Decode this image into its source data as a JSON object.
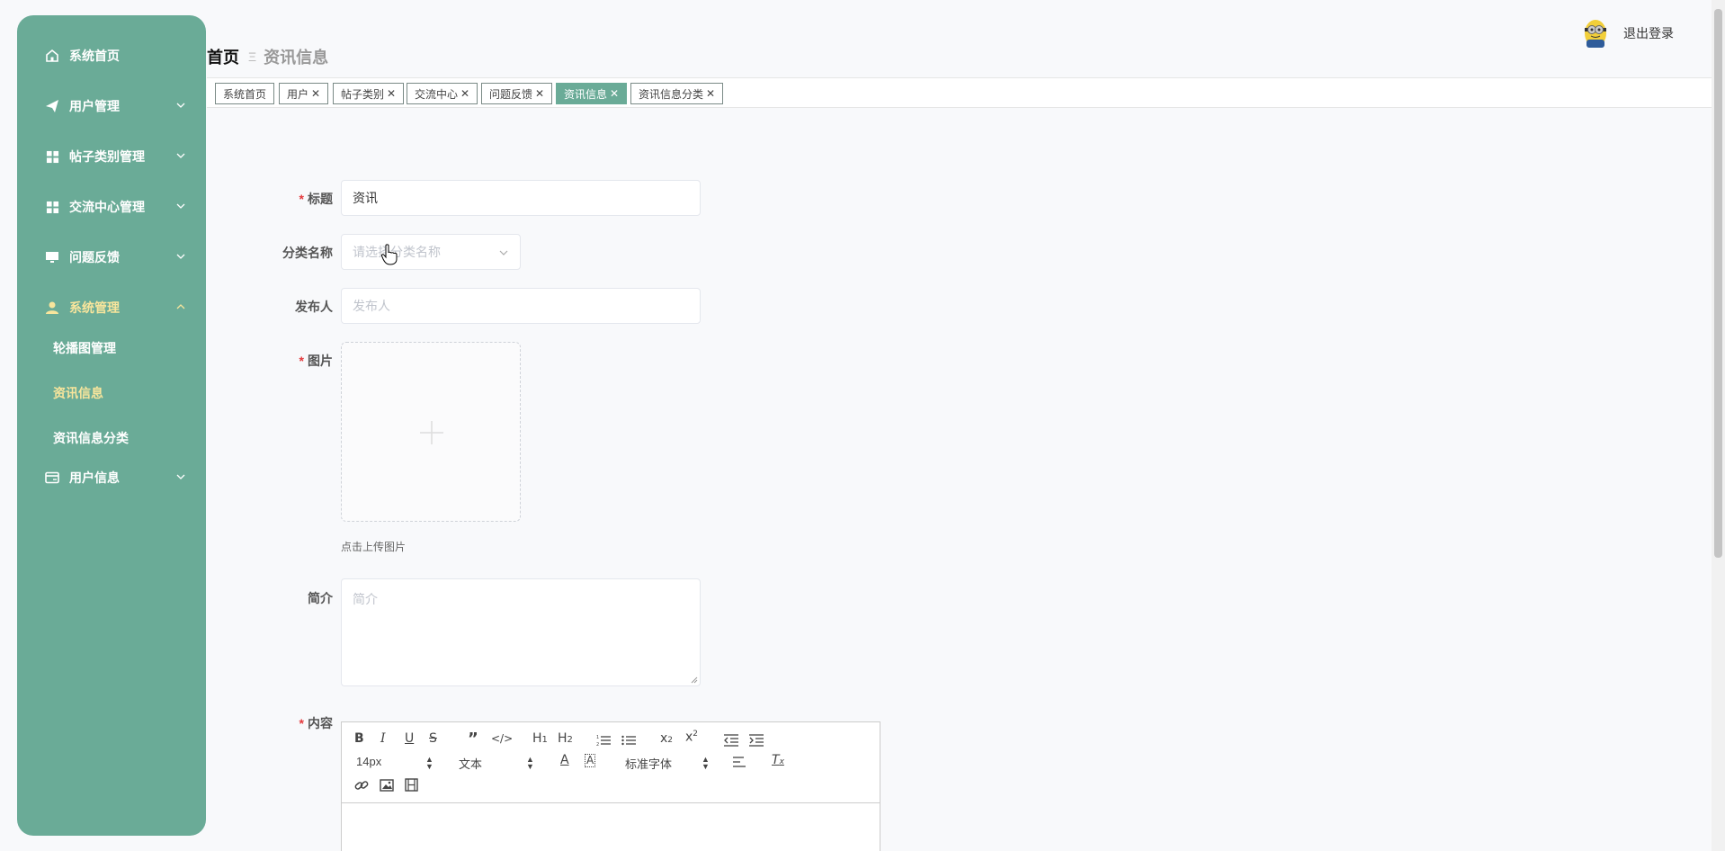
{
  "sidebar": {
    "items": [
      {
        "label": "系统首页",
        "icon": "home-icon",
        "arrow": false
      },
      {
        "label": "用户管理",
        "icon": "send-icon",
        "arrow": "down"
      },
      {
        "label": "帖子类别管理",
        "icon": "grid-icon",
        "arrow": "down"
      },
      {
        "label": "交流中心管理",
        "icon": "grid-icon",
        "arrow": "down"
      },
      {
        "label": "问题反馈",
        "icon": "monitor-icon",
        "arrow": "down"
      },
      {
        "label": "系统管理",
        "icon": "user-icon",
        "arrow": "up",
        "active": true
      },
      {
        "label": "用户信息",
        "icon": "card-icon",
        "arrow": "down"
      }
    ],
    "subitems": [
      {
        "label": "轮播图管理"
      },
      {
        "label": "资讯信息",
        "active": true
      },
      {
        "label": "资讯信息分类"
      }
    ]
  },
  "breadcrumb": {
    "home": "首页",
    "sep": "Ξ",
    "current": "资讯信息"
  },
  "header": {
    "logout": "退出登录"
  },
  "tags": [
    {
      "label": "系统首页",
      "closable": false
    },
    {
      "label": "用户",
      "closable": true
    },
    {
      "label": "帖子类别",
      "closable": true
    },
    {
      "label": "交流中心",
      "closable": true
    },
    {
      "label": "问题反馈",
      "closable": true
    },
    {
      "label": "资讯信息",
      "closable": true,
      "active": true
    },
    {
      "label": "资讯信息分类",
      "closable": true
    }
  ],
  "form": {
    "title": {
      "label": "标题",
      "value": "资讯",
      "required": true
    },
    "category": {
      "label": "分类名称",
      "placeholder": "请选择分类名称"
    },
    "publisher": {
      "label": "发布人",
      "placeholder": "发布人"
    },
    "image": {
      "label": "图片",
      "required": true,
      "hint": "点击上传图片"
    },
    "intro": {
      "label": "简介",
      "placeholder": "简介"
    },
    "content": {
      "label": "内容",
      "required": true
    }
  },
  "editor": {
    "font_size": "14px",
    "header_select": "文本",
    "font_select": "标准字体"
  },
  "colors": {
    "accent": "#6aab97",
    "active_sub": "#f8e59c",
    "required": "#e4393c"
  }
}
